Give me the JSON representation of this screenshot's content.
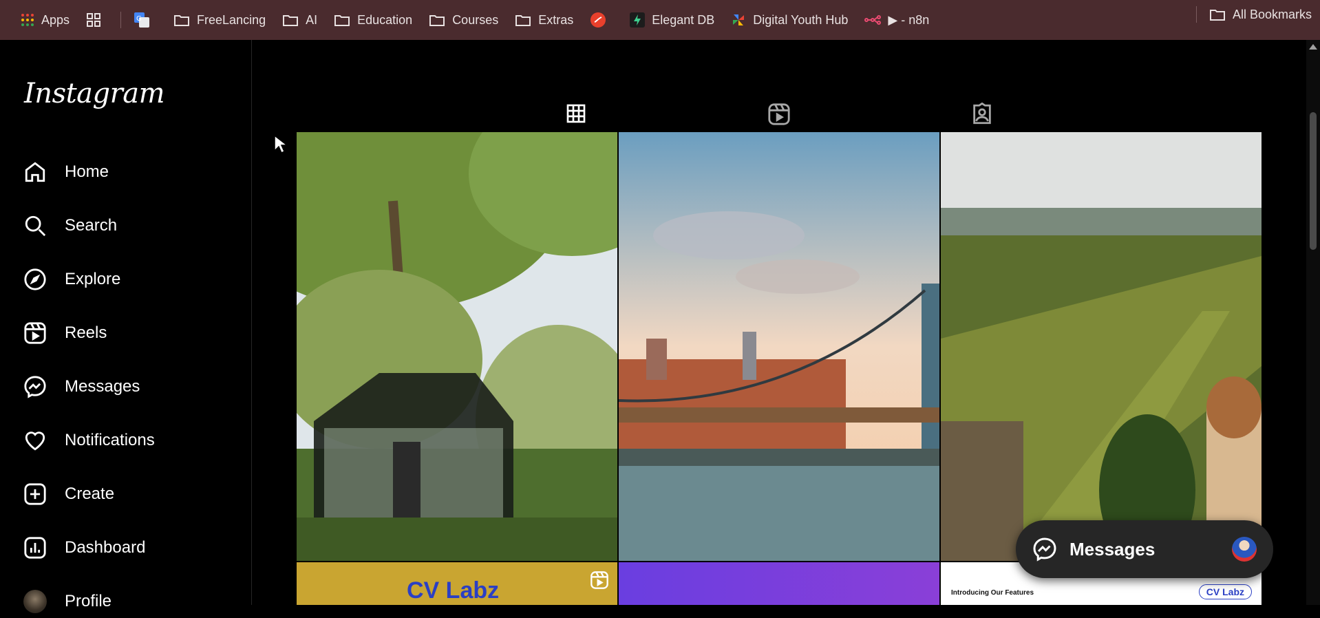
{
  "bookmarks": {
    "apps_label": "Apps",
    "items": [
      {
        "label": "FreeLancing"
      },
      {
        "label": "AI"
      },
      {
        "label": "Education"
      },
      {
        "label": "Courses"
      },
      {
        "label": "Extras"
      },
      {
        "label": "Elegant DB"
      },
      {
        "label": "Digital Youth Hub"
      },
      {
        "label": "▶ - n8n"
      }
    ],
    "all_bookmarks": "All Bookmarks"
  },
  "sidebar": {
    "logo": "Instagram",
    "items": [
      {
        "label": "Home",
        "icon": "home-icon"
      },
      {
        "label": "Search",
        "icon": "search-icon"
      },
      {
        "label": "Explore",
        "icon": "compass-icon"
      },
      {
        "label": "Reels",
        "icon": "reels-icon"
      },
      {
        "label": "Messages",
        "icon": "messenger-icon"
      },
      {
        "label": "Notifications",
        "icon": "heart-icon"
      },
      {
        "label": "Create",
        "icon": "plus-square-icon"
      },
      {
        "label": "Dashboard",
        "icon": "chart-icon"
      },
      {
        "label": "Profile",
        "icon": "avatar"
      }
    ]
  },
  "profile_tabs": [
    {
      "name": "posts",
      "icon": "grid-icon",
      "active": true
    },
    {
      "name": "reels",
      "icon": "reels-icon",
      "active": false
    },
    {
      "name": "tagged",
      "icon": "tagged-icon",
      "active": false
    }
  ],
  "grid_posts": [
    {
      "subject": "greenhouse in garden"
    },
    {
      "subject": "bridge over river at sunset"
    },
    {
      "subject": "vineyard hills with dome"
    },
    {
      "text": "CV Labz",
      "is_reel": true
    },
    {
      "subject": "purple pattern"
    },
    {
      "text": "Introducing Our Features",
      "badge": "CV Labz"
    }
  ],
  "floating_messages": {
    "label": "Messages"
  }
}
